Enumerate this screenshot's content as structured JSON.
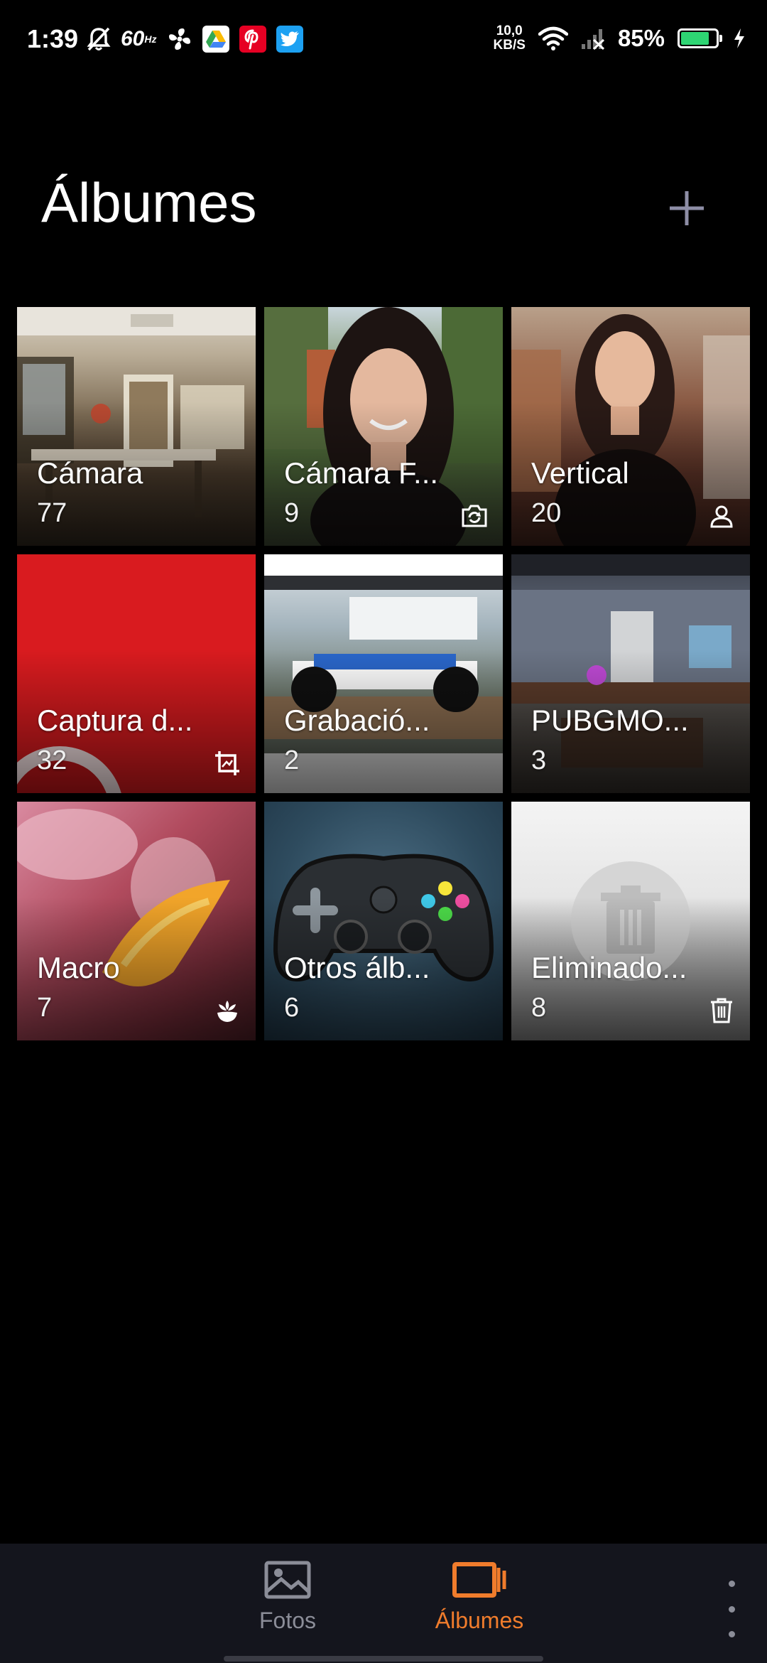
{
  "status_bar": {
    "time": "1:39",
    "refresh_rate": "60",
    "refresh_unit": "Hz",
    "net_speed_value": "10,0",
    "net_speed_unit": "KB/S",
    "battery_percent": "85%",
    "battery_level": 0.85,
    "icons": [
      "mute-icon",
      "fan-icon",
      "google-drive-icon",
      "pinterest-icon",
      "twitter-icon",
      "wifi-icon",
      "signal-icon",
      "battery-icon",
      "charging-icon"
    ]
  },
  "header": {
    "title": "Álbumes",
    "add_icon": "plus-icon"
  },
  "albums": [
    {
      "name": "Cámara",
      "count": "77",
      "badge": ""
    },
    {
      "name": "Cámara F...",
      "count": "9",
      "badge": "front-camera-icon"
    },
    {
      "name": "Vertical",
      "count": "20",
      "badge": "portrait-icon"
    },
    {
      "name": "Captura d...",
      "count": "32",
      "badge": "crop-icon"
    },
    {
      "name": "Grabació...",
      "count": "2",
      "badge": ""
    },
    {
      "name": "PUBGMO...",
      "count": "3",
      "badge": ""
    },
    {
      "name": "Macro",
      "count": "7",
      "badge": "flower-icon"
    },
    {
      "name": "Otros álb...",
      "count": "6",
      "badge": ""
    },
    {
      "name": "Eliminado...",
      "count": "8",
      "badge": "trash-icon"
    }
  ],
  "bottom_nav": {
    "tabs": [
      {
        "label": "Fotos",
        "icon": "photos-icon",
        "active": false
      },
      {
        "label": "Álbumes",
        "icon": "albums-icon",
        "active": true
      }
    ],
    "more_icon": "more-vertical-icon"
  },
  "colors": {
    "accent": "#f07c2c",
    "inactive": "#8b8d98",
    "nav_background": "#14151d",
    "background": "#000000"
  }
}
